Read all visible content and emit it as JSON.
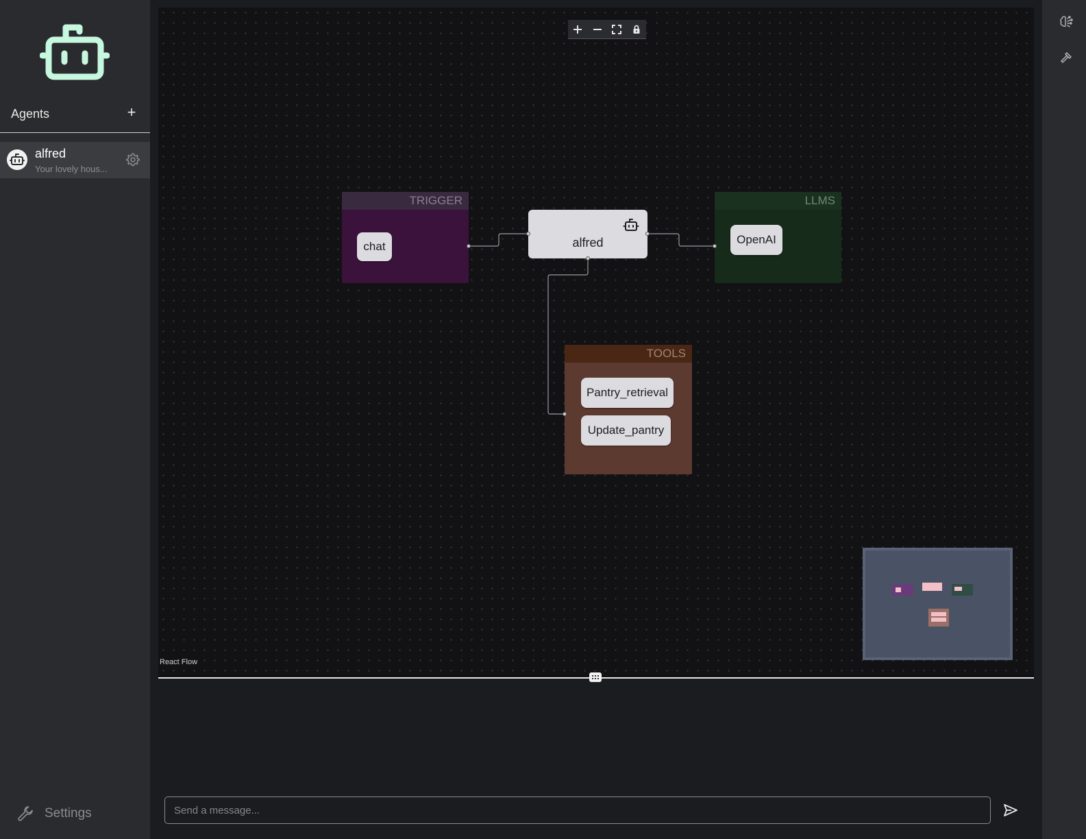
{
  "sidebar": {
    "logo_icon": "robot-icon",
    "agents_title": "Agents",
    "add_label": "+",
    "agents": [
      {
        "name": "alfred",
        "description": "Your lovely hous..."
      }
    ],
    "settings_label": "Settings"
  },
  "canvas": {
    "controls": [
      "zoom-in",
      "zoom-out",
      "fit-view",
      "lock"
    ],
    "groups": {
      "trigger": {
        "title": "TRIGGER",
        "items": [
          "chat"
        ],
        "color": "#3b123c"
      },
      "llms": {
        "title": "LLMS",
        "items": [
          "OpenAI"
        ],
        "color": "#162b1a"
      },
      "tools": {
        "title": "TOOLS",
        "items": [
          "Pantry_retrieval",
          "Update_pantry"
        ],
        "color": "#5c3a30"
      }
    },
    "agent_node": {
      "label": "alfred",
      "icon": "robot-icon"
    },
    "attribution": "React Flow"
  },
  "chat": {
    "placeholder": "Send a message...",
    "value": ""
  },
  "right_rail": {
    "icons": [
      "brain-icon",
      "hammer-icon"
    ]
  },
  "colors": {
    "accent": "#bdf5da",
    "sidebar_bg": "#2a2b2e",
    "canvas_bg": "#121214"
  }
}
